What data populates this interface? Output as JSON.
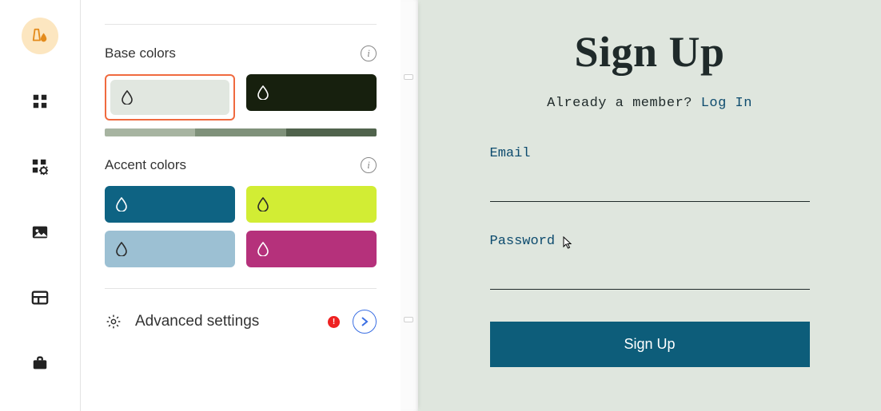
{
  "sections": {
    "base_label": "Base colors",
    "accent_label": "Accent colors",
    "advanced_label": "Advanced settings"
  },
  "base_colors": {
    "swatches": [
      {
        "color": "#e1e7e0",
        "drop": "#2b2b2b",
        "selected": true
      },
      {
        "color": "#17200e",
        "drop": "#ffffff",
        "selected": false
      }
    ],
    "shades": [
      "#a7b4a1",
      "#7f917a",
      "#50634c"
    ]
  },
  "accent_colors": {
    "swatches": [
      {
        "color": "#0e6383",
        "drop": "#ffffff"
      },
      {
        "color": "#d2ed34",
        "drop": "#2b2b2b"
      },
      {
        "color": "#9cc0d3",
        "drop": "#2b2b2b"
      },
      {
        "color": "#b5317b",
        "drop": "#ffffff"
      }
    ]
  },
  "preview": {
    "heading": "Sign Up",
    "subtext_prefix": "Already a member? ",
    "subtext_link": "Log In",
    "email_label": "Email",
    "password_label": "Password",
    "button_label": "Sign Up"
  },
  "alert_glyph": "!"
}
